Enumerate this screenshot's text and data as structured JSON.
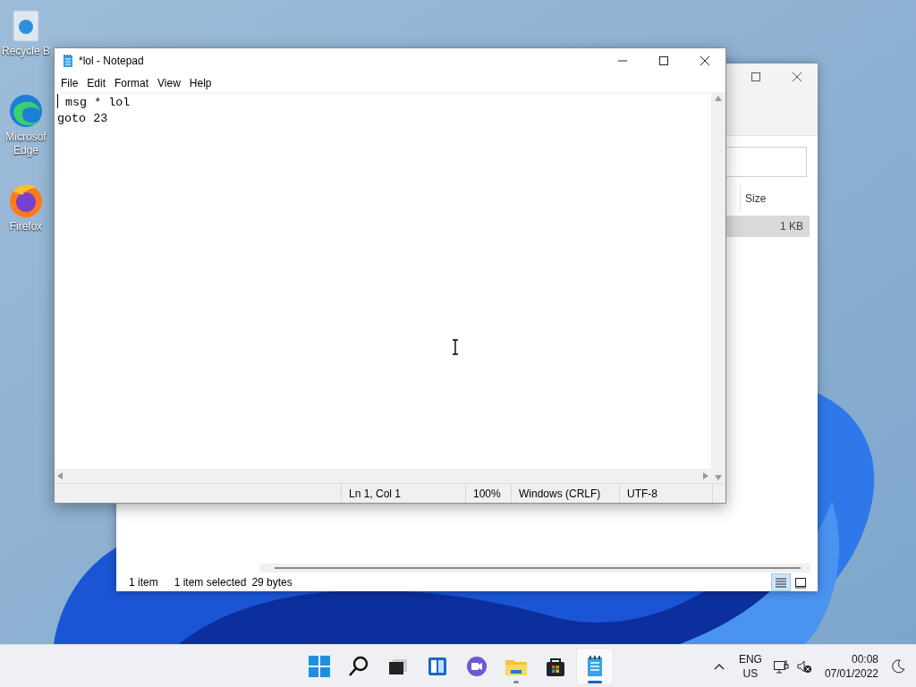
{
  "desktop_icons": [
    {
      "kind": "recycle",
      "lines": [
        "Recycle B"
      ]
    },
    {
      "kind": "edge",
      "lines": [
        "Microsof",
        "Edge"
      ]
    },
    {
      "kind": "firefox",
      "lines": [
        "Firefox"
      ]
    }
  ],
  "explorer": {
    "column_header": "Size",
    "row": {
      "size": "1 KB",
      "selected": true
    },
    "status": {
      "item_count": "1 item",
      "selection": "1 item selected",
      "size": "29 bytes"
    },
    "view_buttons": [
      {
        "kind": "details",
        "selected": true
      },
      {
        "kind": "tiles",
        "selected": false
      }
    ]
  },
  "notepad": {
    "title": "*lol - Notepad",
    "menu": [
      "File",
      "Edit",
      "Format",
      "View",
      "Help"
    ],
    "lines": [
      " msg * lol",
      "goto 23"
    ],
    "status": [
      "Ln 1, Col 1",
      "100%",
      "Windows (CRLF)",
      "UTF-8"
    ]
  },
  "taskbar": {
    "apps": [
      {
        "kind": "start",
        "running": false,
        "selected": false
      },
      {
        "kind": "search",
        "running": false,
        "selected": false
      },
      {
        "kind": "taskview",
        "running": false,
        "selected": false
      },
      {
        "kind": "widgets",
        "running": false,
        "selected": false
      },
      {
        "kind": "chat",
        "running": false,
        "selected": false
      },
      {
        "kind": "explorer",
        "running": true,
        "selected": false
      },
      {
        "kind": "store",
        "running": false,
        "selected": false
      },
      {
        "kind": "notepad",
        "running": true,
        "selected": true
      }
    ],
    "language": [
      "ENG",
      "US"
    ],
    "time": "00:08",
    "date": "07/01/2022"
  }
}
